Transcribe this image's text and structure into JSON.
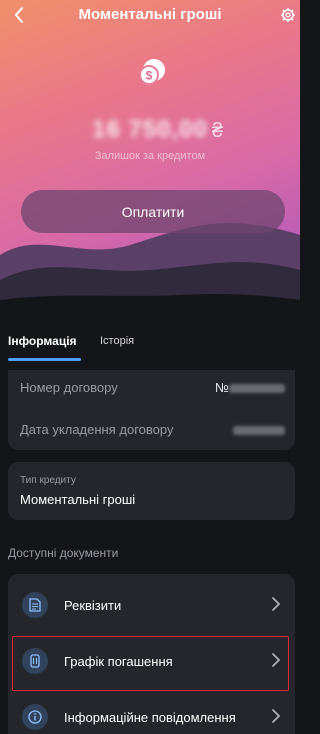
{
  "header": {
    "title": "Моментальні гроші",
    "back_icon": "chevron-left-icon",
    "settings_icon": "gear-icon"
  },
  "account": {
    "balance": "16 750,00",
    "currency": "₴",
    "balance_caption": "Залишок за кредитом",
    "pay_label": "Оплатити"
  },
  "tabs": [
    {
      "label": "Інформація",
      "active": true
    },
    {
      "label": "Історія",
      "active": false
    }
  ],
  "contract": {
    "number_label": "Номер договору",
    "number_prefix": "№",
    "date_label": "Дата укладення договору"
  },
  "credit_type": {
    "label": "Тип кредиту",
    "value": "Моментальні гроші"
  },
  "documents": {
    "section_title": "Доступні документи",
    "items": [
      {
        "label": "Реквізити",
        "icon": "document-icon"
      },
      {
        "label": "Графік погашення",
        "icon": "schedule-icon",
        "highlighted": true
      },
      {
        "label": "Інформаційне повідомлення",
        "icon": "info-icon"
      }
    ]
  },
  "colors": {
    "accent": "#4ea0ff",
    "highlight": "#e0253a",
    "background": "#141519",
    "card": "#24262c"
  }
}
